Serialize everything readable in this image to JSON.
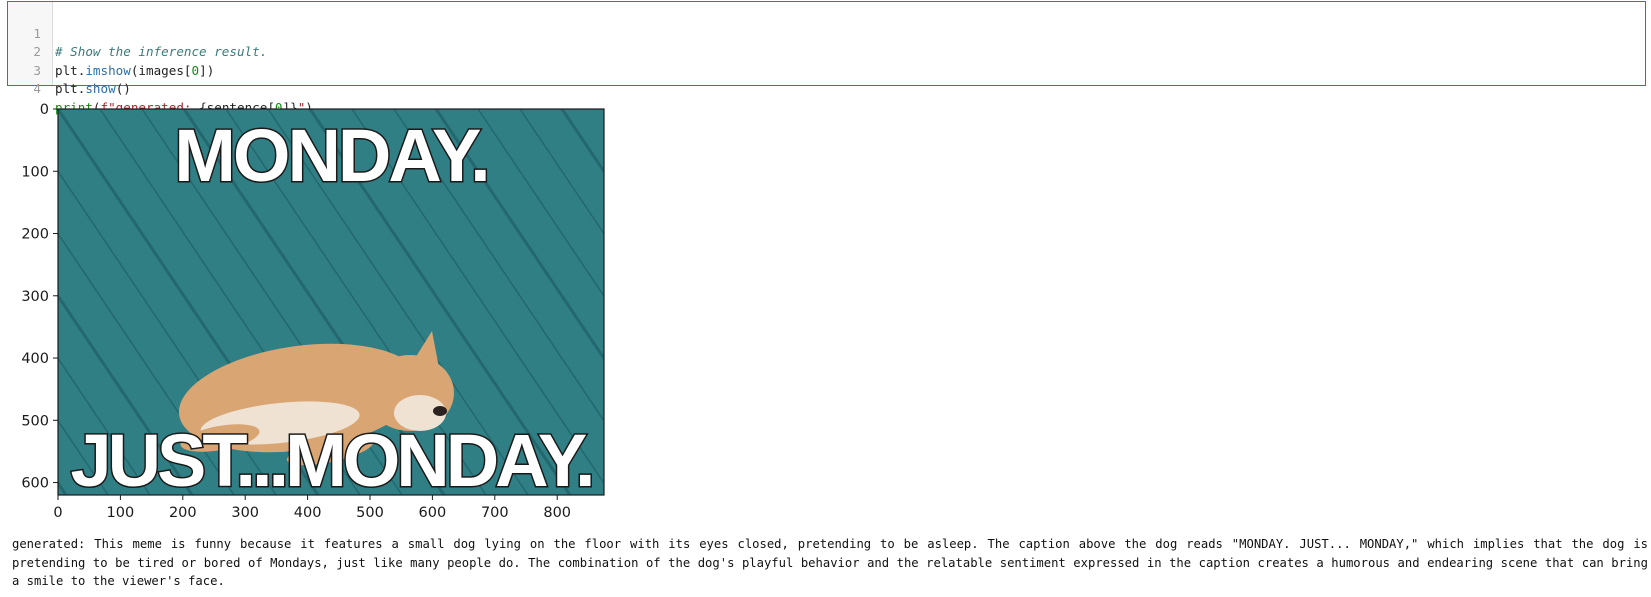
{
  "code_cell": {
    "line_numbers": [
      "1",
      "2",
      "3",
      "4"
    ],
    "line1": {
      "comment": "# Show the inference result."
    },
    "line2": {
      "a": "plt.",
      "b": "imshow",
      "c": "(images[",
      "d": "0",
      "e": "])"
    },
    "line3": {
      "a": "plt.",
      "b": "show",
      "c": "()"
    },
    "line4": {
      "a": "print",
      "b": "(",
      "c": "f\"generated: ",
      "d": "{sentence[",
      "e": "0",
      "f": "]}",
      "g": "\"",
      "h": ")"
    }
  },
  "plot": {
    "y_ticks": [
      "0",
      "100",
      "200",
      "300",
      "400",
      "500",
      "600"
    ],
    "x_ticks": [
      "0",
      "100",
      "200",
      "300",
      "400",
      "500",
      "600",
      "700",
      "800"
    ],
    "y_range": [
      0,
      620
    ],
    "x_range": [
      0,
      875
    ],
    "meme": {
      "top_text": "MONDAY.",
      "bottom_text": "JUST...MONDAY."
    },
    "colors": {
      "deck": "#2f7f85",
      "deck_dark": "#1f5f66",
      "dog": "#d9a573",
      "dog_light": "#efe2d2"
    }
  },
  "output": {
    "text": "generated: This meme is funny because it features a small dog lying on the floor with its eyes closed, pretending to be asleep. The caption above the dog reads \"MONDAY. JUST... MONDAY,\" which implies that the dog is pretending to be tired or bored of Mondays, just like many people do. The combination of the dog's playful behavior and the relatable sentiment expressed in the caption creates a humorous and endearing scene that can bring a smile to the viewer's face."
  }
}
